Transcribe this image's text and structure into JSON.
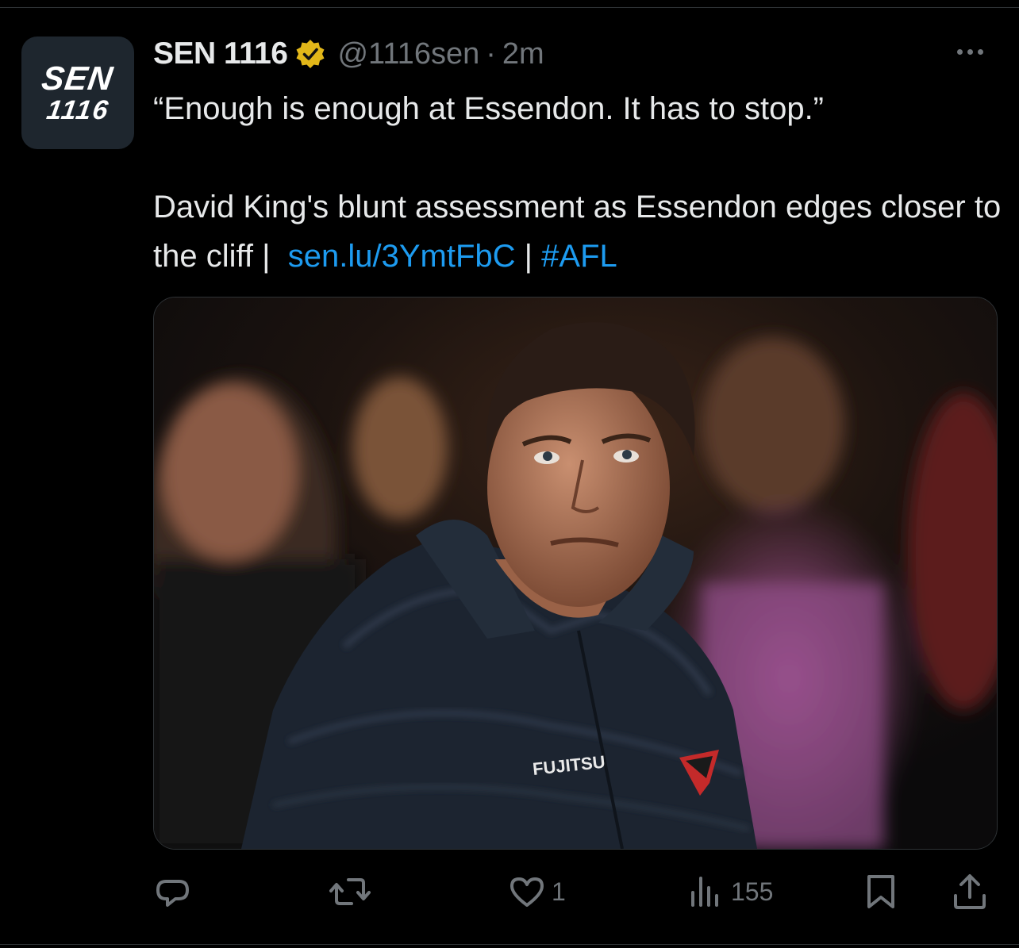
{
  "account": {
    "avatar_line1": "SEN",
    "avatar_line2": "1116",
    "display_name": "SEN 1116",
    "handle": "@1116sen",
    "separator": "·",
    "time": "2m",
    "verified_badge": "gold-check-badge-icon"
  },
  "tweet": {
    "quote": "“Enough is enough at Essendon. It has to stop.”",
    "body": "David King's blunt assessment as Essendon edges closer to the cliff |",
    "link_text": "sen.lu/3YmtFbC",
    "divider": "|",
    "hashtag": "#AFL"
  },
  "media": {
    "jacket_logo_text": "FUJITSU"
  },
  "actions": {
    "reply_icon": "reply-icon",
    "retweet_icon": "retweet-icon",
    "like_icon": "heart-icon",
    "like_count": "1",
    "views_icon": "views-icon",
    "views_count": "155",
    "bookmark_icon": "bookmark-icon",
    "share_icon": "share-icon"
  },
  "colors": {
    "background": "#000000",
    "text": "#e7e9ea",
    "muted": "#71767b",
    "link": "#1d9bf0",
    "badge": "#e2b719"
  }
}
